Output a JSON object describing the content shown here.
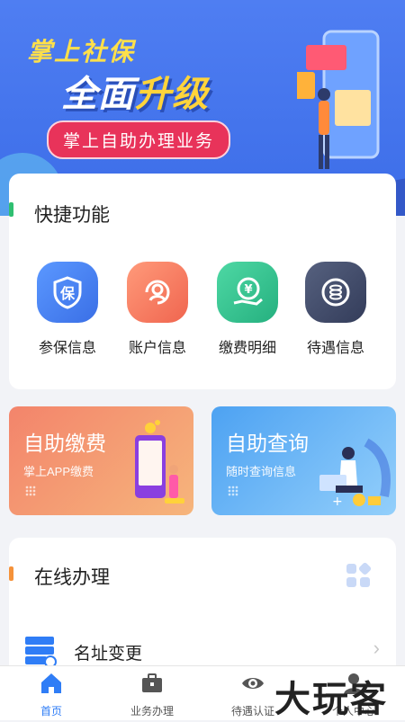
{
  "banner": {
    "line1": "掌上社保",
    "line2_a": "全面",
    "line2_b": "升级",
    "pill": "掌上自助办理业务"
  },
  "quick": {
    "title": "快捷功能",
    "items": [
      {
        "label": "参保信息",
        "icon": "shield-bao-icon",
        "color": "#3d7cf5"
      },
      {
        "label": "账户信息",
        "icon": "user-refresh-icon",
        "color": "#f3765c"
      },
      {
        "label": "缴费明细",
        "icon": "yuan-hand-icon",
        "color": "#34c08f"
      },
      {
        "label": "待遇信息",
        "icon": "coin-stack-icon",
        "color": "#3f4a6b"
      }
    ]
  },
  "promos": [
    {
      "title": "自助缴费",
      "subtitle": "掌上APP缴费"
    },
    {
      "title": "自助查询",
      "subtitle": "随时查询信息"
    }
  ],
  "online": {
    "title": "在线办理",
    "items": [
      {
        "label": "名址变更",
        "icon": "server-list-icon"
      }
    ]
  },
  "tabbar": {
    "items": [
      {
        "label": "首页",
        "icon": "home-icon"
      },
      {
        "label": "业务办理",
        "icon": "briefcase-icon"
      },
      {
        "label": "待遇认证",
        "icon": "eye-icon"
      },
      {
        "label": "个人中心",
        "icon": "person-icon"
      }
    ]
  },
  "watermark": "大玩客"
}
